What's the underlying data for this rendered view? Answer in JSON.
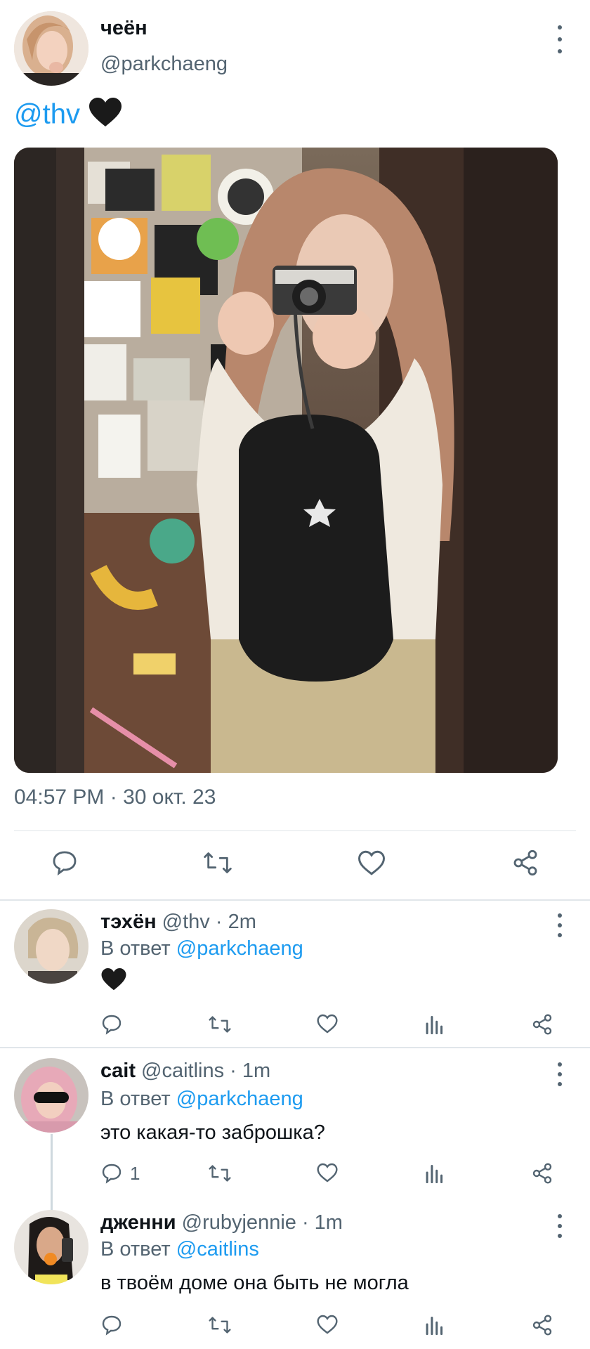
{
  "main_tweet": {
    "display_name": "чеён",
    "handle": "@parkchaeng",
    "mention": "@thv",
    "timestamp": "04:57 PM · 30 окт. 23"
  },
  "replies": [
    {
      "display_name": "тэхён",
      "meta": "@thv · 2m",
      "reply_prefix": "В ответ",
      "reply_to": "@parkchaeng",
      "reply_count": ""
    },
    {
      "display_name": "cait",
      "meta": "@caitlins · 1m",
      "reply_prefix": "В ответ",
      "reply_to": "@parkchaeng",
      "body": "это какая-то заброшка?",
      "reply_count": "1"
    },
    {
      "display_name": "дженни",
      "meta": "@rubyjennie · 1m",
      "reply_prefix": "В ответ",
      "reply_to": "@caitlins",
      "body": "в твоём доме она быть не могла",
      "reply_count": ""
    }
  ],
  "colors": {
    "accent": "#1d9bf0",
    "secondary_text": "#536471",
    "divider": "#e1e6ea"
  },
  "icons": [
    "more-icon",
    "reply-icon",
    "retweet-icon",
    "like-icon",
    "views-icon",
    "share-icon",
    "black-heart-emoji"
  ]
}
